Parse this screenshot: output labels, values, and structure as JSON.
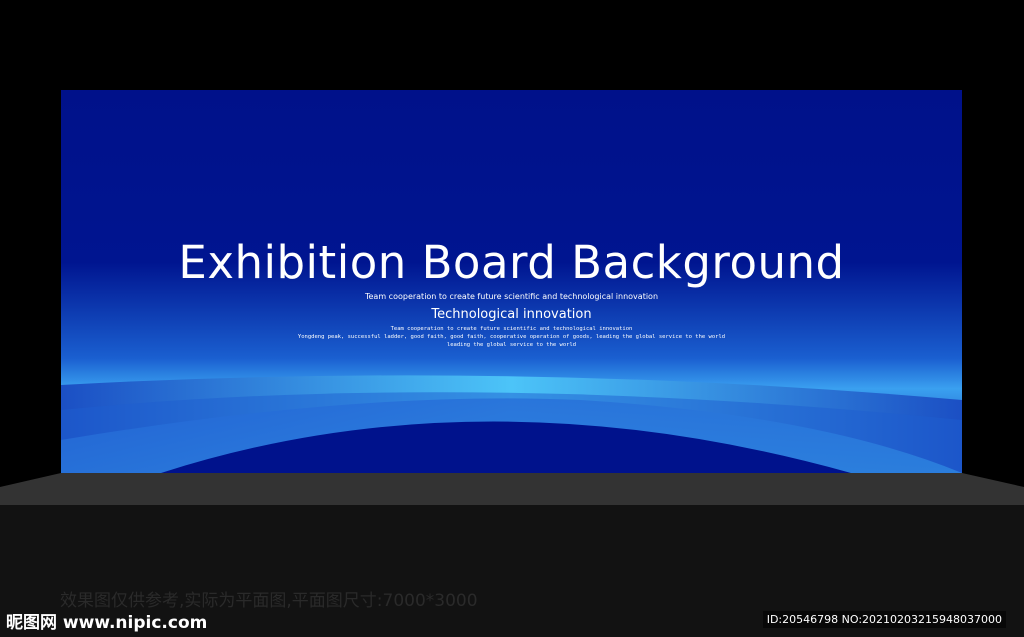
{
  "board": {
    "title": "Exhibition Board Background",
    "subtitle1": "Team cooperation to create future scientific and technological innovation",
    "subtitle2": "Technological innovation",
    "line3": "Team cooperation to create future scientific and technological innovation",
    "line4": "Yongdeng peak, successful ladder, good faith, good faith, cooperative operation of goods, leading the global service to the world",
    "line5": "leading the global service to the world"
  },
  "footer": {
    "note": "效果图仅供参考,实际为平面图,平面图尺寸:7000*3000",
    "logo": "昵图网 www.nipic.com",
    "id": "ID:20546798 NO:20210203215948037000"
  },
  "colors": {
    "board": "#00128c",
    "glow": "#4ab8f5",
    "floor": "#333333"
  }
}
